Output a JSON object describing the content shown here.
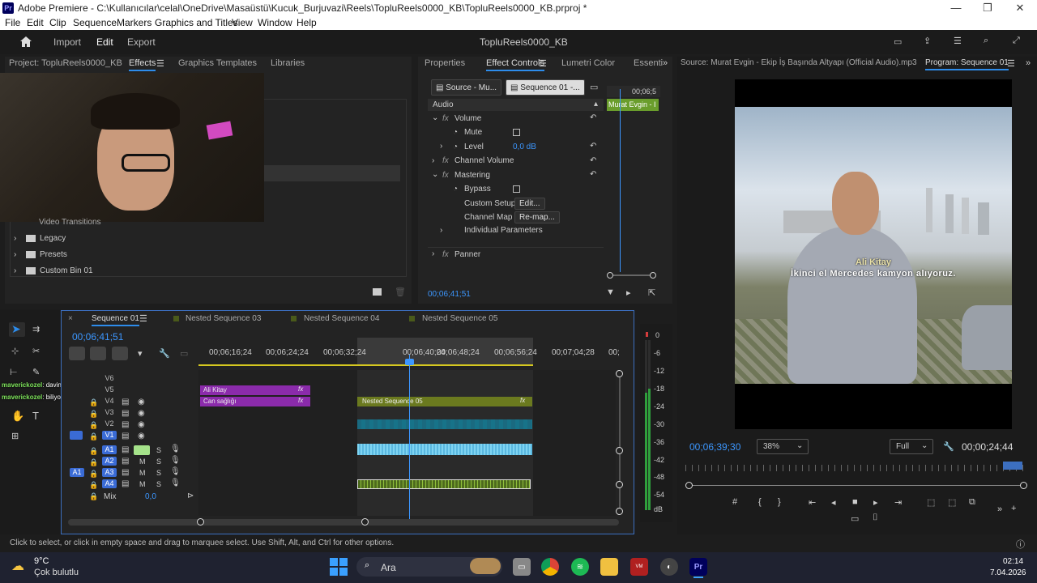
{
  "window": {
    "title": "Adobe Premiere - C:\\Kullanıcılar\\celal\\OneDrive\\Masaüstü\\Kucuk_Burjuvazi\\Reels\\TopluReels0000_KB\\TopluReels0000_KB.prproj *",
    "logo": "Pr"
  },
  "menu": [
    "File",
    "Edit",
    "Clip",
    "Sequence",
    "Markers",
    "Graphics and Titles",
    "View",
    "Window",
    "Help"
  ],
  "header": {
    "home": "home-icon",
    "import": "Import",
    "edit": "Edit",
    "export": "Export",
    "project_title": "TopluReels0000_KB"
  },
  "left_panel": {
    "tabs": [
      "Project: TopluReels0000_KB",
      "Effects",
      "Graphics Templates",
      "Libraries"
    ],
    "items": [
      "Video Transitions",
      "Legacy",
      "Presets",
      "Custom Bin 01"
    ]
  },
  "effect_controls": {
    "tabs": [
      "Properties",
      "Effect Controls",
      "Lumetri Color",
      "Essenti"
    ],
    "source_btn": "Source - Mu...",
    "seq_btn": "Sequence 01 -...",
    "timecode_mini": "00;06;5",
    "clip_label": "Murat Evgin - I",
    "audio_label": "Audio",
    "volume": "Volume",
    "mute": "Mute",
    "level": "Level",
    "level_value": "0,0 dB",
    "channel_volume": "Channel Volume",
    "mastering": "Mastering",
    "bypass": "Bypass",
    "custom_setup": "Custom Setup",
    "edit_btn": "Edit...",
    "channel_map": "Channel Map",
    "remap_btn": "Re-map...",
    "individual_params": "Individual Parameters",
    "panner": "Panner",
    "timecode": "00;06;41;51"
  },
  "program": {
    "source_tab": "Source: Murat Evgin - Ekip İş Başında  Altyapı (Official Audio).mp3",
    "program_tab": "Program: Sequence 01",
    "caption_name": "Ali Kitay",
    "caption_text": "İkinci el Mercedes kamyon alıyoruz.",
    "timecode": "00;06;39;30",
    "zoom": "38%",
    "quality": "Full",
    "duration": "00;00;24;44"
  },
  "timeline": {
    "tabs": [
      "Sequence 01",
      "Nested Sequence 03",
      "Nested Sequence 04",
      "Nested Sequence 05"
    ],
    "timecode": "00;06;41;51",
    "ruler": [
      "00;06;16;24",
      "00;06;24;24",
      "00;06;32;24",
      "00;06;40;24",
      "00;06;48;24",
      "00;06;56;24",
      "00;07;04;28",
      "00;"
    ],
    "tracks": [
      "V6",
      "V5",
      "V4",
      "V3",
      "V2",
      "V1",
      "A1",
      "A2",
      "A3",
      "A4"
    ],
    "mix": "Mix",
    "mix_value": "0,0",
    "clips": {
      "ali": "Ali Kitay",
      "can": "Can sağlığı",
      "nested": "Nested Sequence 05"
    },
    "chat1_user": "maverickozel",
    "chat1_text": ": davinci de boyle bir sey var mı peki",
    "chat2_user": "maverickozel",
    "chat2_text": ": biliyor musun"
  },
  "meter": {
    "labels": [
      "0",
      "-6",
      "-12",
      "-18",
      "-24",
      "-30",
      "-36",
      "-42",
      "-48",
      "-54",
      "dB"
    ]
  },
  "status": {
    "text": "Click to select, or click in empty space and drag to marquee select. Use Shift, Alt, and Ctrl for other options."
  },
  "taskbar": {
    "temp": "9°C",
    "weather": "Çok bulutlu",
    "search": "Ara",
    "time": "02:14",
    "date": "7.04.2026"
  }
}
